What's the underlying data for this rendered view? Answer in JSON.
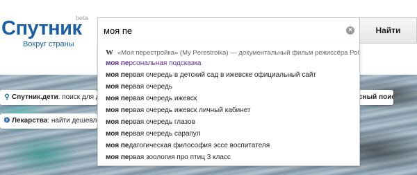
{
  "logo": {
    "word": "Спутник",
    "beta": "beta",
    "tagline": "Вокруг страны"
  },
  "search": {
    "value": "моя пе",
    "placeholder": "",
    "button_label": "Найти"
  },
  "suggestions": [
    {
      "type": "wiki",
      "text": "«Моя перестройка» (My Perestroika) — документальный фильм режиссёра Робин Хессман."
    },
    {
      "type": "query",
      "bold": "моя пе",
      "rest": "рсональная подсказка",
      "selected": true
    },
    {
      "type": "query",
      "bold": "моя пе",
      "rest": "рвая очередь в детский сад в ижевске официальный сайт"
    },
    {
      "type": "query",
      "bold": "моя пе",
      "rest": "рвая очередь"
    },
    {
      "type": "query",
      "bold": "моя пе",
      "rest": "рвая очередь ижевск"
    },
    {
      "type": "query",
      "bold": "моя пе",
      "rest": "рвая очередь ижевск личный кабинет"
    },
    {
      "type": "query",
      "bold": "моя пе",
      "rest": "рвая очередь глазов"
    },
    {
      "type": "query",
      "bold": "моя пе",
      "rest": "рвая очередь сарапул"
    },
    {
      "type": "query",
      "bold": "моя пе",
      "rest": "дагогическая философия эссе воспитателя"
    },
    {
      "type": "query",
      "bold": "моя пе",
      "rest": "рвая зоология про птиц 3 класс"
    }
  ],
  "pills": {
    "kids": {
      "bold": "Спутник.дети",
      "rest": ": поиск для детей"
    },
    "meds": {
      "bold": "Лекарства",
      "rest": ": найти дешевле"
    },
    "right": "сный поиск"
  },
  "icons": {
    "clear": "clear-icon",
    "wiki": "wikipedia-icon",
    "search": "search-icon",
    "pill": "pill-icon",
    "caret": "caret-down-icon"
  },
  "colors": {
    "brand": "#1b5fa8",
    "selected_suggestion": "#5b2f96"
  }
}
